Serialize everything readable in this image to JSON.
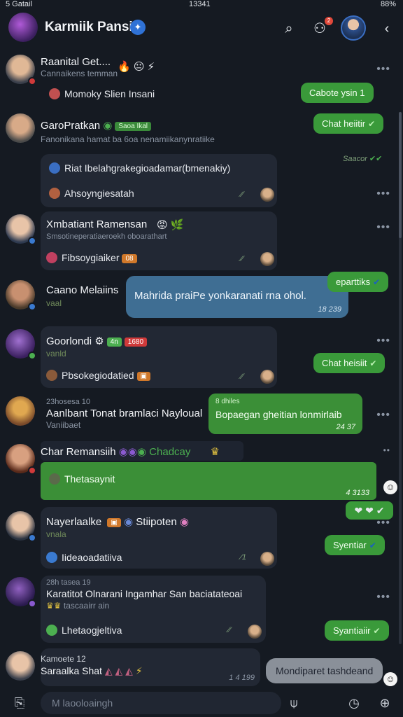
{
  "status": {
    "signal": "5 Gatail",
    "time": "13341",
    "battery": "88%"
  },
  "header": {
    "title": "Karmiik Pansii",
    "notif_count": "2"
  },
  "messages": [
    {
      "name": "Raanital Get....",
      "sub": "Cannaikens temman",
      "line": "Momoky Slien Insani",
      "reply": "Cabote ysin 1"
    },
    {
      "name": "GaroPratkan",
      "tag": "Saoa Ikal",
      "sub": "Fanonikana hamat  ba 6oa nenamiikanynratiike",
      "reply": "Chat heiitir",
      "time": "Saacor"
    },
    {
      "line1": "Riat Ibelahgrakegioadamar(bmenakiy)",
      "line2": "Ahsoyngiesatah"
    },
    {
      "name": "Xmbatiant Ramensan",
      "sub": "Smsotineperatiaeroekh oboarathart",
      "line": "Fibsoygiaiker",
      "tag": "08"
    },
    {
      "name": "Caano Melaiins",
      "sub": "vaal",
      "bubble": "Mahrida praiPe yonkaranati rna ohol.",
      "btime": "18 239",
      "reply": "eparttiks"
    },
    {
      "name": "Goorlondi",
      "tag1": "4n",
      "tag2": "1680",
      "sub": "vanld",
      "line": "Pbsokegiodatied",
      "reply": "Chat heisiit"
    },
    {
      "sub_top": "23hosesa 10",
      "name": "Aanlbant Tonat bramlaci Nayloual",
      "sub": "Vaniibaet",
      "bubble_tag": "8 dhiles",
      "bubble": "Bopaegan gheitian lonmirlaib",
      "btime": "24 37"
    },
    {
      "name": "Char Remansiih",
      "extra": "Chadcay",
      "line": "Thetasaynit",
      "time": "4 3133"
    },
    {
      "name": "Nayerlaalke",
      "extra": "Stiipoten",
      "sub": "vnala",
      "line": "Iideaoadatiiva",
      "reply": "Syentiar"
    },
    {
      "sub_top": "28h tasea 19",
      "name": "Karatitot Olnarani Ingamhar San baciatateoai",
      "sub": "tascaairr ain",
      "line": "Lhetaogjeltiva",
      "reply": "Syantiaiir"
    },
    {
      "name": "Kamoete 12",
      "sub": "Saraalka Shat",
      "bubble": "Mondiparet tashdeand",
      "btime": "1 4 199"
    }
  ],
  "composer": {
    "placeholder": "M laooloaingh"
  }
}
